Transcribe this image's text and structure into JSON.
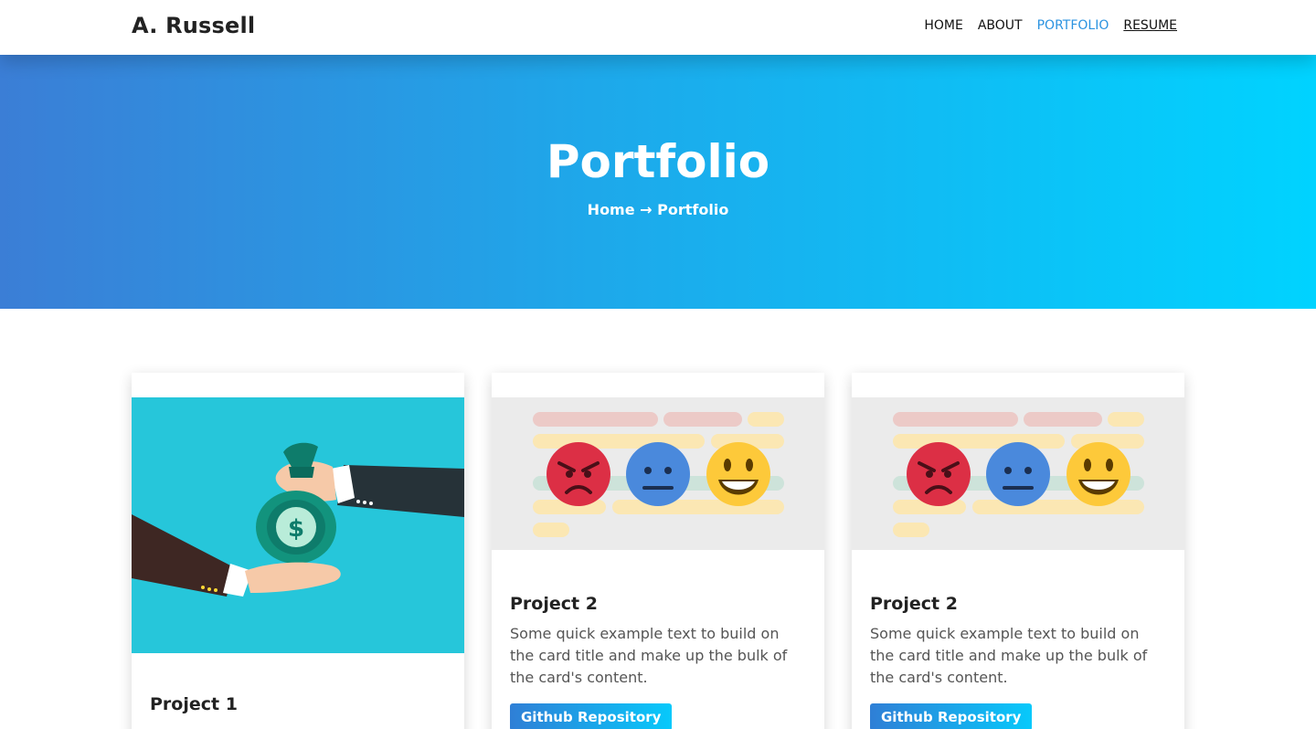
{
  "navbar": {
    "brand": "A. Russell",
    "links": [
      {
        "label": "HOME"
      },
      {
        "label": "ABOUT"
      },
      {
        "label": "PORTFOLIO"
      },
      {
        "label": "RESUME"
      }
    ]
  },
  "hero": {
    "title": "Portfolio",
    "breadcrumb": {
      "home": "Home",
      "arrow": "→",
      "current": "Portfolio"
    }
  },
  "cards": [
    {
      "title": "Project 1",
      "image_icon": "money-bag-handoff-illustration"
    },
    {
      "title": "Project 2",
      "text": "Some quick example text to build on the card title and make up the bulk of the card's content.",
      "button": "Github Repository",
      "image_icon": "emoji-feedback-illustration"
    },
    {
      "title": "Project 2",
      "text": "Some quick example text to build on the card title and make up the bulk of the card's content.",
      "button": "Github Repository",
      "image_icon": "emoji-feedback-illustration"
    }
  ],
  "colors": {
    "accent": "#2b93e0",
    "hero_gradient_start": "#3b7ed6",
    "hero_gradient_end": "#00d3ff",
    "card1_image_bg": "#26c6da"
  }
}
